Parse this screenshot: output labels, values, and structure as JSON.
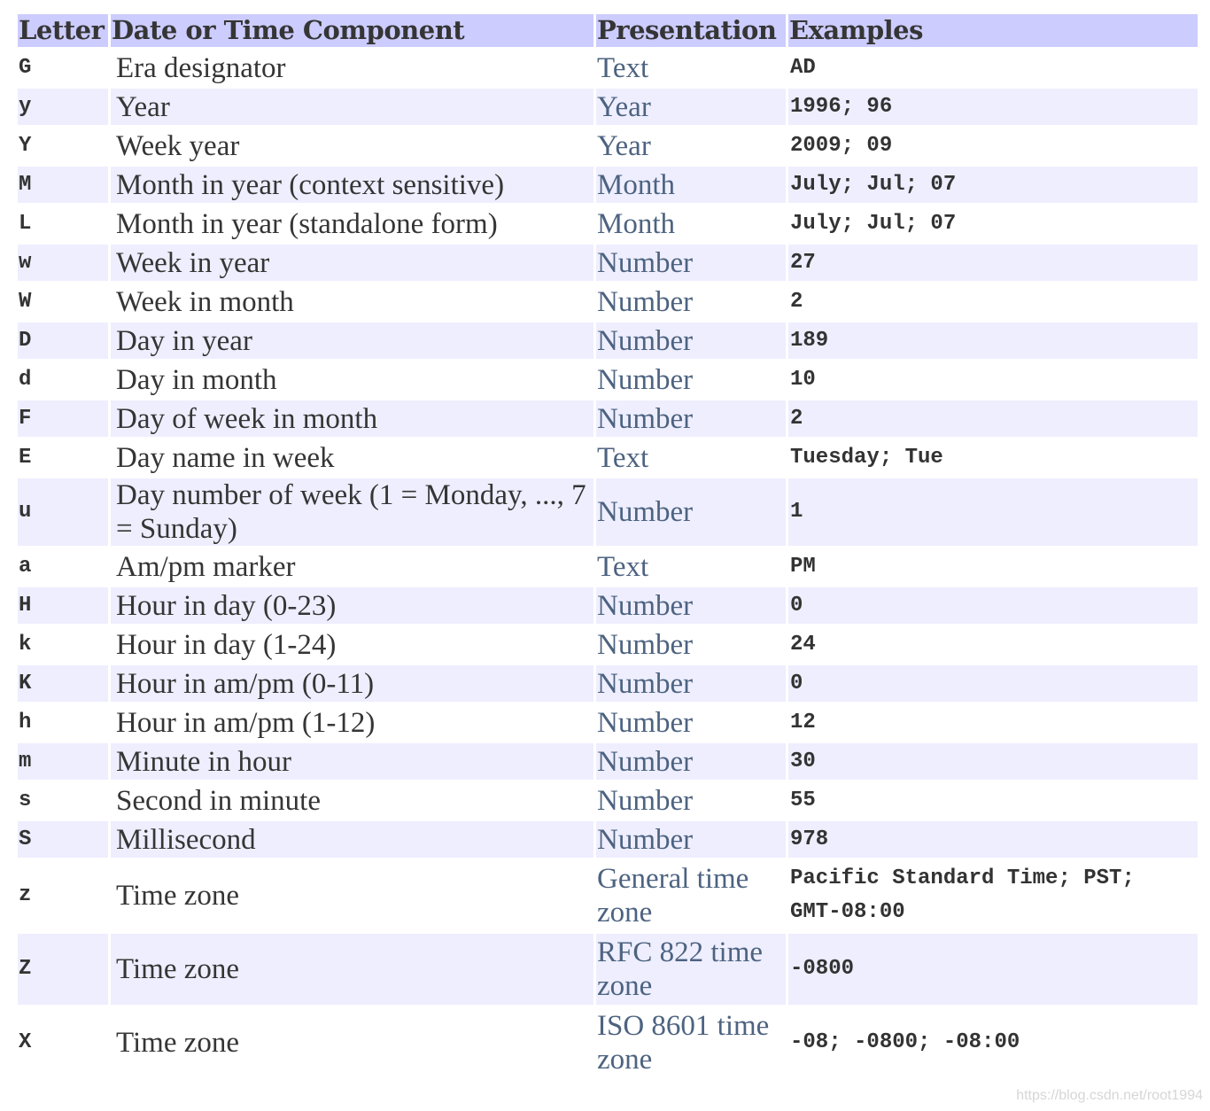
{
  "headers": [
    "Letter",
    "Date or Time Component",
    "Presentation",
    "Examples"
  ],
  "rows": [
    {
      "letter": "G",
      "component": "Era designator",
      "presentation": "Text",
      "examples": "AD"
    },
    {
      "letter": "y",
      "component": "Year",
      "presentation": "Year",
      "examples": "1996; 96"
    },
    {
      "letter": "Y",
      "component": "Week year",
      "presentation": "Year",
      "examples": "2009; 09"
    },
    {
      "letter": "M",
      "component": "Month in year (context sensitive)",
      "presentation": "Month",
      "examples": "July; Jul; 07"
    },
    {
      "letter": "L",
      "component": "Month in year (standalone form)",
      "presentation": "Month",
      "examples": "July; Jul; 07"
    },
    {
      "letter": "w",
      "component": "Week in year",
      "presentation": "Number",
      "examples": "27"
    },
    {
      "letter": "W",
      "component": "Week in month",
      "presentation": "Number",
      "examples": "2"
    },
    {
      "letter": "D",
      "component": "Day in year",
      "presentation": "Number",
      "examples": "189"
    },
    {
      "letter": "d",
      "component": "Day in month",
      "presentation": "Number",
      "examples": "10"
    },
    {
      "letter": "F",
      "component": "Day of week in month",
      "presentation": "Number",
      "examples": "2"
    },
    {
      "letter": "E",
      "component": "Day name in week",
      "presentation": "Text",
      "examples": "Tuesday; Tue"
    },
    {
      "letter": "u",
      "component": "Day number of week (1 = Monday, ..., 7 = Sunday)",
      "presentation": "Number",
      "examples": "1"
    },
    {
      "letter": "a",
      "component": "Am/pm marker",
      "presentation": "Text",
      "examples": "PM"
    },
    {
      "letter": "H",
      "component": "Hour in day (0-23)",
      "presentation": "Number",
      "examples": "0"
    },
    {
      "letter": "k",
      "component": "Hour in day (1-24)",
      "presentation": "Number",
      "examples": "24"
    },
    {
      "letter": "K",
      "component": "Hour in am/pm (0-11)",
      "presentation": "Number",
      "examples": "0"
    },
    {
      "letter": "h",
      "component": "Hour in am/pm (1-12)",
      "presentation": "Number",
      "examples": "12"
    },
    {
      "letter": "m",
      "component": "Minute in hour",
      "presentation": "Number",
      "examples": "30"
    },
    {
      "letter": "s",
      "component": "Second in minute",
      "presentation": "Number",
      "examples": "55"
    },
    {
      "letter": "S",
      "component": "Millisecond",
      "presentation": "Number",
      "examples": "978"
    },
    {
      "letter": "z",
      "component": "Time zone",
      "presentation": "General time zone",
      "examples": "Pacific Standard Time; PST; GMT-08:00"
    },
    {
      "letter": "Z",
      "component": "Time zone",
      "presentation": "RFC 822 time zone",
      "examples": "-0800"
    },
    {
      "letter": "X",
      "component": "Time zone",
      "presentation": "ISO 8601 time zone",
      "examples": "-08; -0800; -08:00"
    }
  ],
  "watermark": "https://blog.csdn.net/root1994",
  "colors": {
    "header_bg": "#ccccff",
    "stripe_bg": "#eeeeff",
    "presentation_text": "#4d6380"
  }
}
